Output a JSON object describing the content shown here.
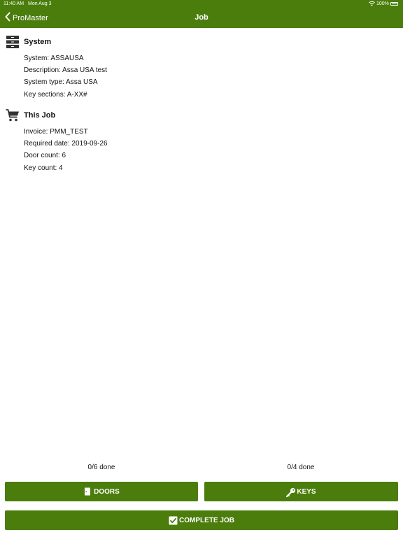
{
  "status_bar": {
    "time": "11:40 AM",
    "date": "Mon Aug 3",
    "battery": "100%"
  },
  "nav": {
    "back_label": "ProMaster",
    "title": "Job"
  },
  "system": {
    "title": "System",
    "icon": "server-icon",
    "details": [
      "System: ASSAUSA",
      "Description: Assa USA test",
      "System type: Assa USA",
      "Key sections: A-XX#"
    ]
  },
  "job": {
    "title": "This Job",
    "icon": "cart-icon",
    "details": [
      "Invoice: PMM_TEST",
      "Required date: 2019-09-26",
      "Door count: 6",
      "Key count: 4"
    ]
  },
  "progress": {
    "doors": "0/6 done",
    "keys": "0/4 done"
  },
  "actions": {
    "doors_label": "DOORS",
    "keys_label": "KEYS",
    "complete_label": "COMPLETE JOB"
  },
  "colors": {
    "primary": "#4a7d0c",
    "text": "#111111",
    "background": "#ffffff"
  }
}
